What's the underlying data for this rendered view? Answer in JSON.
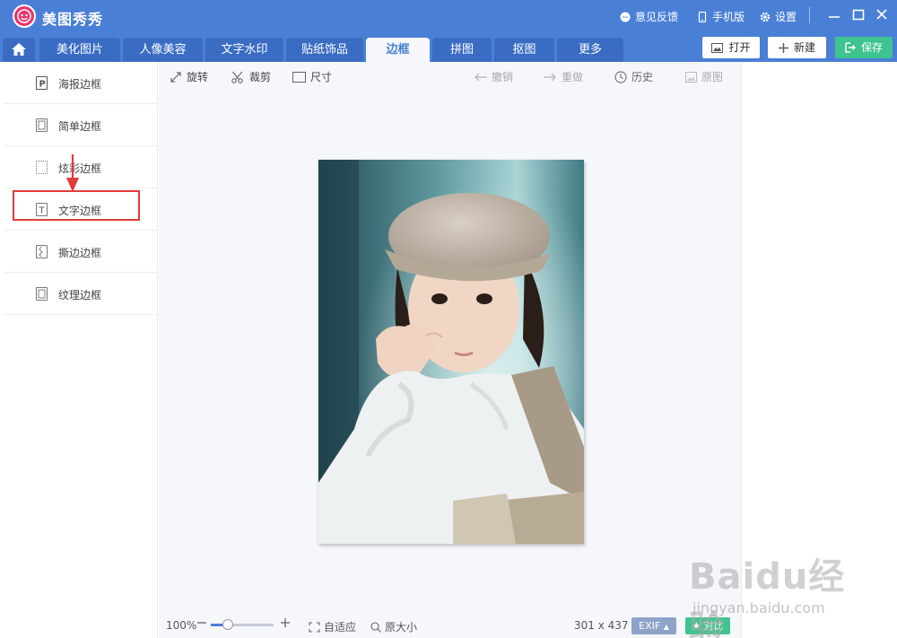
{
  "app": {
    "title": "美图秀秀"
  },
  "titlebar": {
    "feedback": "意见反馈",
    "mobile": "手机版",
    "settings": "设置"
  },
  "tabs": [
    {
      "label": "美化图片"
    },
    {
      "label": "人像美容"
    },
    {
      "label": "文字水印"
    },
    {
      "label": "贴纸饰品"
    },
    {
      "label": "边框",
      "active": true
    },
    {
      "label": "拼图"
    },
    {
      "label": "抠图"
    },
    {
      "label": "更多"
    }
  ],
  "header_buttons": {
    "open": "打开",
    "new": "新建",
    "save": "保存"
  },
  "sidebar": {
    "items": [
      {
        "label": "海报边框",
        "icon": "poster-frame-icon"
      },
      {
        "label": "简单边框",
        "icon": "simple-frame-icon"
      },
      {
        "label": "炫彩边框",
        "icon": "colorful-frame-icon"
      },
      {
        "label": "文字边框",
        "icon": "text-frame-icon",
        "highlighted": true
      },
      {
        "label": "撕边边框",
        "icon": "torn-frame-icon"
      },
      {
        "label": "纹理边框",
        "icon": "texture-frame-icon"
      }
    ]
  },
  "toolbar": {
    "rotate": "旋转",
    "crop": "裁剪",
    "size": "尺寸",
    "undo": "撤销",
    "redo": "重做",
    "history": "历史",
    "original": "原图"
  },
  "status": {
    "zoom": "100%",
    "zoom_level": 0.28,
    "fit": "自适应",
    "actual_size": "原大小",
    "dimensions": "301 x 437",
    "exif": "EXIF",
    "compare": "对比"
  },
  "watermark": {
    "main": "Baidu经验",
    "sub": "jingyan.baidu.com"
  },
  "colors": {
    "accent": "#4a7fd6",
    "save": "#3ec48f",
    "highlight": "#e33b3b"
  }
}
